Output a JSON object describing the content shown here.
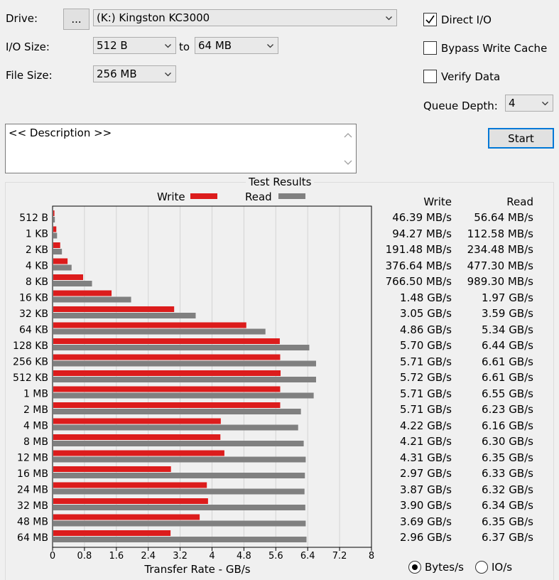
{
  "drive": {
    "label": "Drive:",
    "browse_label": "...",
    "value": "(K:) Kingston KC3000"
  },
  "io_size": {
    "label": "I/O Size:",
    "from": "512 B",
    "to_label": "to",
    "to": "64 MB"
  },
  "file_size": {
    "label": "File Size:",
    "value": "256 MB"
  },
  "options": {
    "direct_io": {
      "label": "Direct I/O",
      "checked": true
    },
    "bypass_write_cache": {
      "label": "Bypass Write Cache",
      "checked": false
    },
    "verify_data": {
      "label": "Verify Data",
      "checked": false
    },
    "queue_depth": {
      "label": "Queue Depth:",
      "value": "4"
    }
  },
  "start_label": "Start",
  "description": "<< Description >>",
  "results": {
    "title": "Test Results",
    "write_legend": "Write",
    "read_legend": "Read",
    "write_header": "Write",
    "read_header": "Read",
    "write_values": [
      "46.39 MB/s",
      "94.27 MB/s",
      "191.48 MB/s",
      "376.64 MB/s",
      "766.50 MB/s",
      "1.48 GB/s",
      "3.05 GB/s",
      "4.86 GB/s",
      "5.70 GB/s",
      "5.71 GB/s",
      "5.72 GB/s",
      "5.71 GB/s",
      "5.71 GB/s",
      "4.22 GB/s",
      "4.21 GB/s",
      "4.31 GB/s",
      "2.97 GB/s",
      "3.87 GB/s",
      "3.90 GB/s",
      "3.69 GB/s",
      "2.96 GB/s"
    ],
    "read_values": [
      "56.64 MB/s",
      "112.58 MB/s",
      "234.48 MB/s",
      "477.30 MB/s",
      "989.30 MB/s",
      "1.97 GB/s",
      "3.59 GB/s",
      "5.34 GB/s",
      "6.44 GB/s",
      "6.61 GB/s",
      "6.61 GB/s",
      "6.55 GB/s",
      "6.23 GB/s",
      "6.16 GB/s",
      "6.30 GB/s",
      "6.35 GB/s",
      "6.33 GB/s",
      "6.32 GB/s",
      "6.34 GB/s",
      "6.35 GB/s",
      "6.37 GB/s"
    ]
  },
  "units": {
    "bytes_label": "Bytes/s",
    "bytes_selected": true,
    "io_label": "IO/s",
    "io_selected": false
  },
  "colors": {
    "write": "#dc1c1c",
    "read": "#808080"
  },
  "chart_data": {
    "type": "bar",
    "orientation": "horizontal",
    "categories": [
      "512 B",
      "1 KB",
      "2 KB",
      "4 KB",
      "8 KB",
      "16 KB",
      "32 KB",
      "64 KB",
      "128 KB",
      "256 KB",
      "512 KB",
      "1 MB",
      "2 MB",
      "4 MB",
      "8 MB",
      "12 MB",
      "16 MB",
      "24 MB",
      "32 MB",
      "48 MB",
      "64 MB"
    ],
    "series": [
      {
        "name": "Write",
        "values": [
          0.04639,
          0.09427,
          0.19148,
          0.37664,
          0.7665,
          1.48,
          3.05,
          4.86,
          5.7,
          5.71,
          5.72,
          5.71,
          5.71,
          4.22,
          4.21,
          4.31,
          2.97,
          3.87,
          3.9,
          3.69,
          2.96
        ]
      },
      {
        "name": "Read",
        "values": [
          0.05664,
          0.11258,
          0.23448,
          0.4773,
          0.9893,
          1.97,
          3.59,
          5.34,
          6.44,
          6.61,
          6.61,
          6.55,
          6.23,
          6.16,
          6.3,
          6.35,
          6.33,
          6.32,
          6.34,
          6.35,
          6.37
        ]
      }
    ],
    "xlabel": "Transfer Rate - GB/s",
    "xlim": [
      0,
      8
    ],
    "xticks": [
      "0",
      "0.8",
      "1.6",
      "2.4",
      "3.2",
      "4",
      "4.8",
      "5.6",
      "6.4",
      "7.2",
      "8"
    ],
    "grid": true,
    "legend": "top"
  }
}
